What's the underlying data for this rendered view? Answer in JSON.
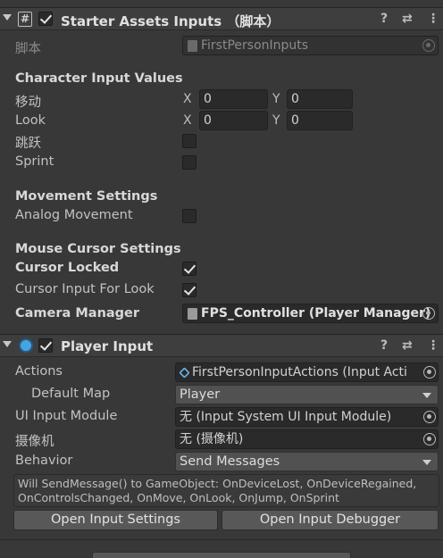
{
  "component1": {
    "title": "Starter Assets Inputs （脚本）",
    "script_label": "脚本",
    "script_value": "FirstPersonInputs",
    "section_char": "Character Input Values",
    "move_label": "移动",
    "look_label": "Look",
    "jump_label": "跳跃",
    "sprint_label": "Sprint",
    "x_axis": "X",
    "y_axis": "Y",
    "move_x": "0",
    "move_y": "0",
    "look_x": "0",
    "look_y": "0",
    "section_movement": "Movement Settings",
    "analog_label": "Analog Movement",
    "section_mouse": "Mouse Cursor Settings",
    "cursor_locked_label": "Cursor Locked",
    "cursor_look_label": "Cursor Input For Look",
    "camera_label": "Camera Manager",
    "camera_value": "FPS_Controller (Player Manager)",
    "icon_help": "?",
    "icon_presets": "⇄",
    "icon_more": "⋮"
  },
  "component2": {
    "title": "Player Input",
    "actions_label": "Actions",
    "actions_value": "FirstPersonInputActions (Input Acti",
    "default_map_label": "Default Map",
    "default_map_value": "Player",
    "ui_module_label": "UI Input Module",
    "ui_module_value": "无 (Input System UI Input Module)",
    "camera_label": "摄像机",
    "camera_value": "无 (摄像机)",
    "behavior_label": "Behavior",
    "behavior_value": "Send Messages",
    "help_text": "Will SendMessage() to GameObject: OnDeviceLost, OnDeviceRegained, OnControlsChanged, OnMove, OnLook, OnJump, OnSprint",
    "open_settings": "Open Input Settings",
    "open_debugger": "Open Input Debugger"
  }
}
